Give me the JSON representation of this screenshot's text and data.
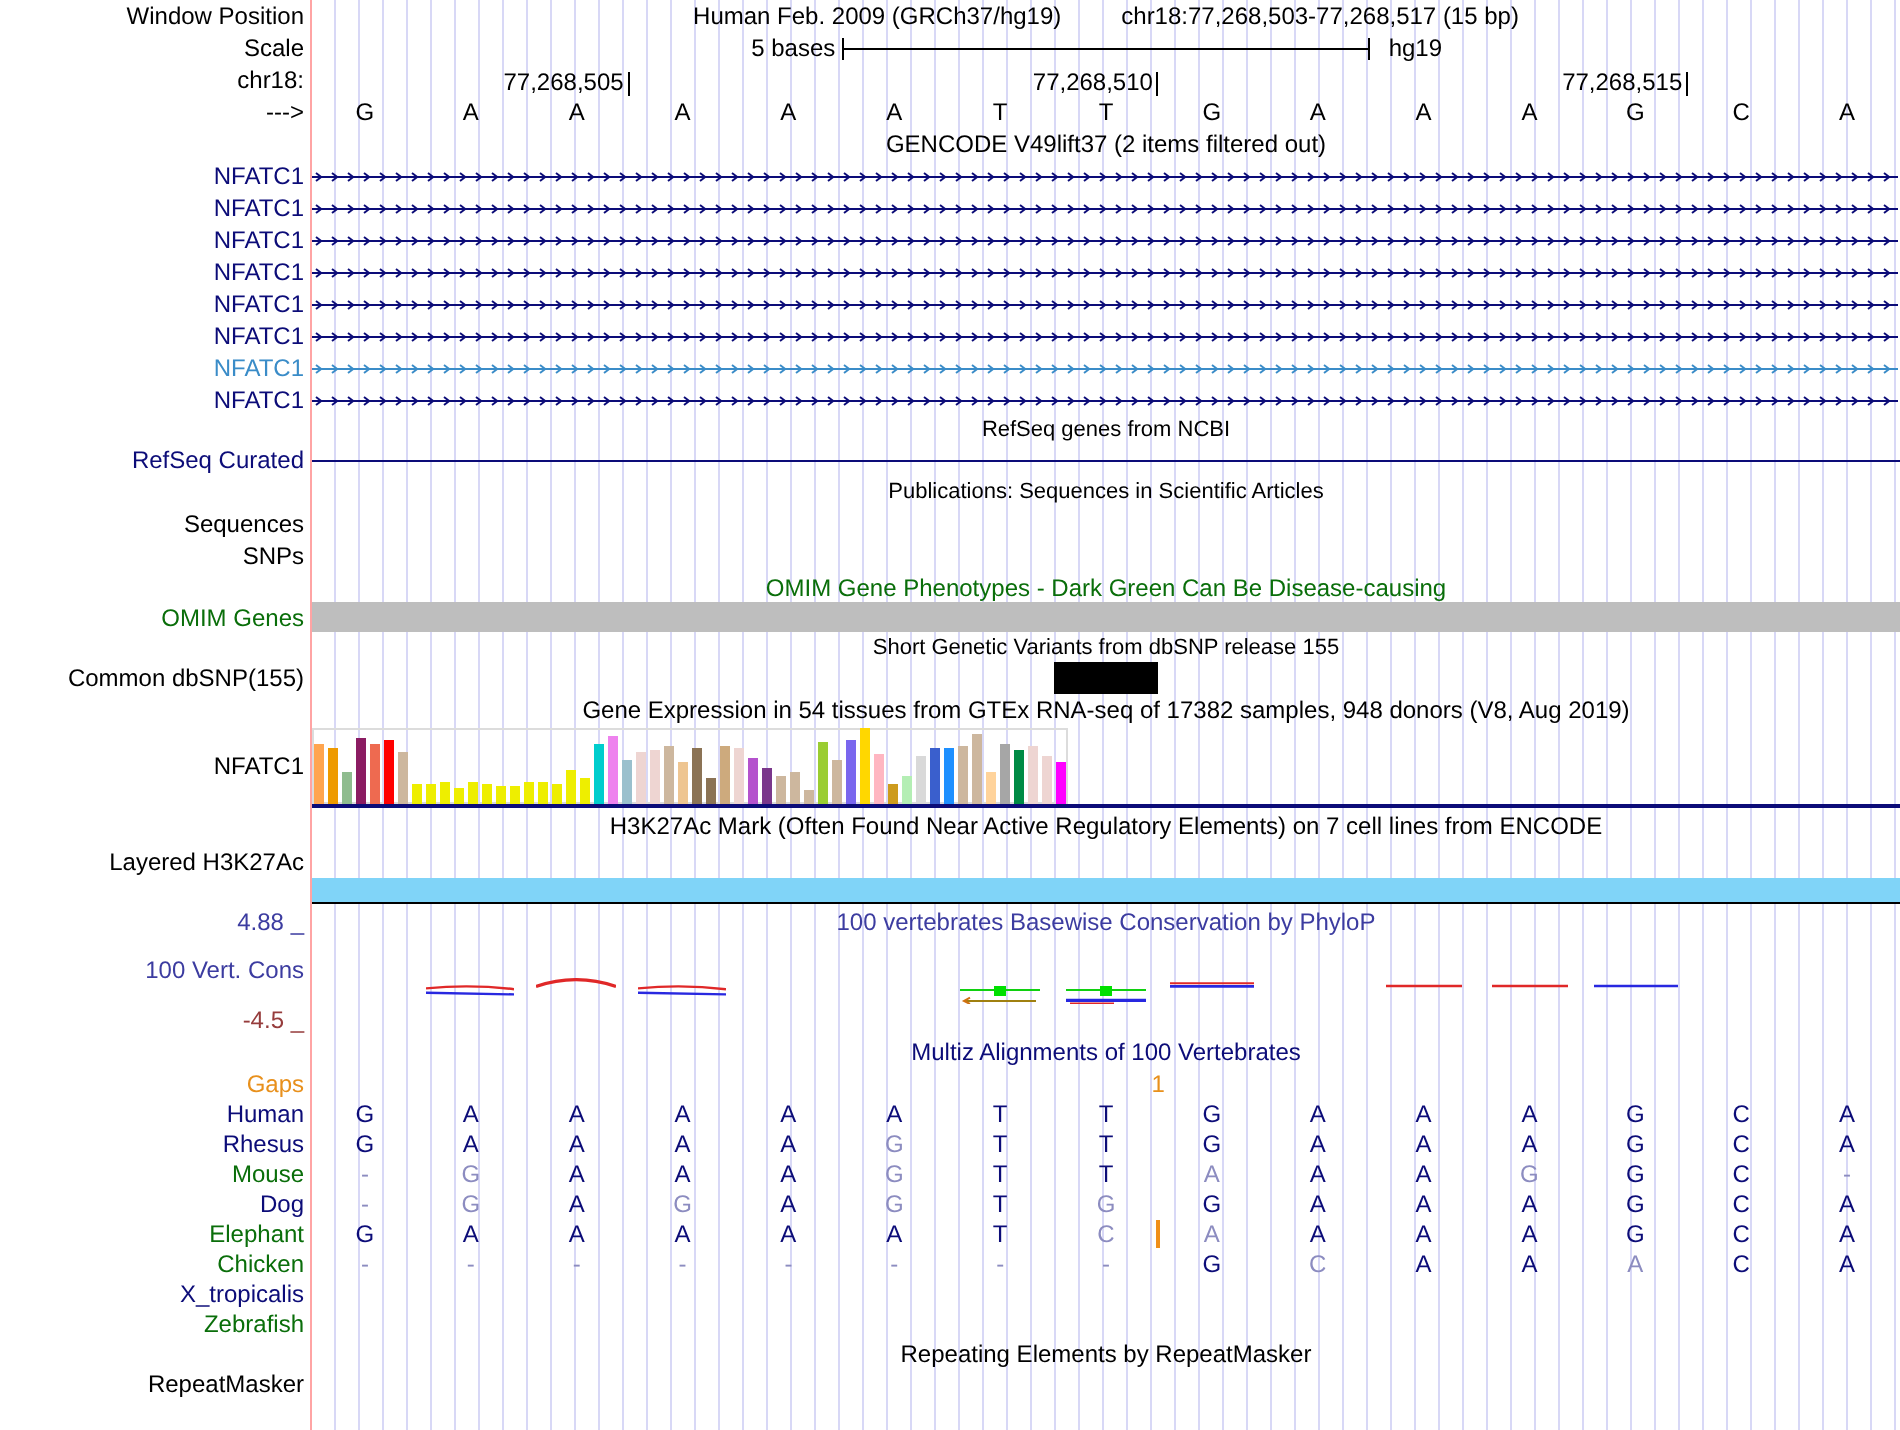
{
  "header": {
    "window_position": {
      "label": "Window Position",
      "assembly": "Human Feb. 2009 (GRCh37/hg19)",
      "position": "chr18:77,268,503-77,268,517 (15 bp)"
    },
    "scale": {
      "label": "Scale",
      "size": "5 bases",
      "assembly": "hg19"
    },
    "ruler": {
      "label": "chr18:",
      "ticks": [
        "77,268,505",
        "77,268,510",
        "77,268,515"
      ]
    },
    "strand": {
      "label": "--->",
      "bases": [
        "G",
        "A",
        "A",
        "A",
        "A",
        "A",
        "T",
        "T",
        "G",
        "A",
        "A",
        "A",
        "G",
        "C",
        "A"
      ]
    }
  },
  "gencode": {
    "title": "GENCODE V49lift37 (2 items filtered out)",
    "items": [
      {
        "label": "NFATC1",
        "color": "#0c0c78"
      },
      {
        "label": "NFATC1",
        "color": "#0c0c78"
      },
      {
        "label": "NFATC1",
        "color": "#0c0c78"
      },
      {
        "label": "NFATC1",
        "color": "#0c0c78"
      },
      {
        "label": "NFATC1",
        "color": "#0c0c78"
      },
      {
        "label": "NFATC1",
        "color": "#0c0c78"
      },
      {
        "label": "NFATC1",
        "color": "#3a8cc8"
      },
      {
        "label": "NFATC1",
        "color": "#0c0c78"
      }
    ]
  },
  "refseq": {
    "title": "RefSeq genes from NCBI",
    "label": "RefSeq Curated"
  },
  "publications": {
    "title": "Publications: Sequences in Scientific Articles",
    "labels": [
      "Sequences",
      "SNPs"
    ]
  },
  "omim": {
    "title": "OMIM Gene Phenotypes - Dark Green Can Be Disease-causing",
    "label": "OMIM Genes"
  },
  "dbsnp": {
    "title": "Short Genetic Variants from dbSNP release 155",
    "label": "Common dbSNP(155)",
    "columns": [
      {
        "variant": false
      },
      {
        "variant": false
      },
      {
        "variant": false
      },
      {
        "variant": false
      },
      {
        "variant": false
      },
      {
        "variant": false
      },
      {
        "variant": false
      },
      {
        "variant": true
      },
      {
        "variant": false
      },
      {
        "variant": false
      },
      {
        "variant": false
      },
      {
        "variant": false
      },
      {
        "variant": false
      },
      {
        "variant": false
      },
      {
        "variant": false
      }
    ]
  },
  "gtex": {
    "title": "Gene Expression in 54 tissues from GTEx RNA-seq of 17382 samples, 948 donors (V8, Aug 2019)",
    "label": "NFATC1",
    "tissues": [
      {
        "color": "#ffa54f"
      },
      {
        "color": "#ee9a00"
      },
      {
        "color": "#8fbc8f"
      },
      {
        "color": "#8b1c62"
      },
      {
        "color": "#ee6a50"
      },
      {
        "color": "#ff0000"
      },
      {
        "color": "#cdb79e"
      },
      {
        "color": "#eeee00"
      },
      {
        "color": "#eeee00"
      },
      {
        "color": "#eeee00"
      },
      {
        "color": "#eeee00"
      },
      {
        "color": "#eeee00"
      },
      {
        "color": "#eeee00"
      },
      {
        "color": "#eeee00"
      },
      {
        "color": "#eeee00"
      },
      {
        "color": "#eeee00"
      },
      {
        "color": "#eeee00"
      },
      {
        "color": "#eeee00"
      },
      {
        "color": "#eeee00"
      },
      {
        "color": "#eeee00"
      },
      {
        "color": "#00cdcd"
      },
      {
        "color": "#ee82ee"
      },
      {
        "color": "#9ac0cd"
      },
      {
        "color": "#eed5d2"
      },
      {
        "color": "#eed5d2"
      },
      {
        "color": "#cdb79e"
      },
      {
        "color": "#eec591"
      },
      {
        "color": "#8b7355"
      },
      {
        "color": "#8b7355"
      },
      {
        "color": "#cdaa7d"
      },
      {
        "color": "#eed5d2"
      },
      {
        "color": "#b452cd"
      },
      {
        "color": "#7a378b"
      },
      {
        "color": "#cdb79e"
      },
      {
        "color": "#cdb79e"
      },
      {
        "color": "#cdb79e"
      },
      {
        "color": "#9acd32"
      },
      {
        "color": "#cdb79e"
      },
      {
        "color": "#7a67ee"
      },
      {
        "color": "#ffd700"
      },
      {
        "color": "#ffb6c1"
      },
      {
        "color": "#cd9b1d"
      },
      {
        "color": "#b4eeb4"
      },
      {
        "color": "#d9d9d9"
      },
      {
        "color": "#3a5fcd"
      },
      {
        "color": "#1e90ff"
      },
      {
        "color": "#cdb79e"
      },
      {
        "color": "#cdb79e"
      },
      {
        "color": "#ffd39b"
      },
      {
        "color": "#a6a6a6"
      },
      {
        "color": "#008b45"
      },
      {
        "color": "#eed5d2"
      },
      {
        "color": "#eed5d2"
      },
      {
        "color": "#ff00ff"
      }
    ]
  },
  "h3k27ac": {
    "title": "H3K27Ac Mark (Often Found Near Active Regulatory Elements) on 7 cell lines from ENCODE",
    "label": "Layered H3K27Ac"
  },
  "phylop": {
    "title": "100 vertebrates Basewise Conservation by PhyloP",
    "label": "100 Vert. Cons",
    "max": "4.88 _",
    "min": "-4.5 _"
  },
  "multiz": {
    "title": "Multiz Alignments of 100 Vertebrates",
    "gaps": {
      "label": "Gaps",
      "columns": [
        {
          "insertion": false
        },
        {
          "insertion": false
        },
        {
          "insertion": false
        },
        {
          "insertion": false
        },
        {
          "insertion": false
        },
        {
          "insertion": false
        },
        {
          "insertion": false
        },
        {
          "insertion": true,
          "count": "1"
        },
        {
          "insertion": false
        },
        {
          "insertion": false
        },
        {
          "insertion": false
        },
        {
          "insertion": false
        },
        {
          "insertion": false
        },
        {
          "insertion": false
        },
        {
          "insertion": false
        }
      ]
    },
    "species": [
      {
        "name": "Human",
        "color": "#0c0c78",
        "bases": [
          {
            "base": "G",
            "mismatch": false
          },
          {
            "base": "A",
            "mismatch": false
          },
          {
            "base": "A",
            "mismatch": false
          },
          {
            "base": "A",
            "mismatch": false
          },
          {
            "base": "A",
            "mismatch": false
          },
          {
            "base": "A",
            "mismatch": false
          },
          {
            "base": "T",
            "mismatch": false
          },
          {
            "base": "T",
            "mismatch": false
          },
          {
            "base": "G",
            "mismatch": false
          },
          {
            "base": "A",
            "mismatch": false
          },
          {
            "base": "A",
            "mismatch": false
          },
          {
            "base": "A",
            "mismatch": false
          },
          {
            "base": "G",
            "mismatch": false
          },
          {
            "base": "C",
            "mismatch": false
          },
          {
            "base": "A",
            "mismatch": false
          }
        ]
      },
      {
        "name": "Rhesus",
        "color": "#0c0c78",
        "bases": [
          {
            "base": "G",
            "mismatch": false
          },
          {
            "base": "A",
            "mismatch": false
          },
          {
            "base": "A",
            "mismatch": false
          },
          {
            "base": "A",
            "mismatch": false
          },
          {
            "base": "A",
            "mismatch": false
          },
          {
            "base": "G",
            "mismatch": true
          },
          {
            "base": "T",
            "mismatch": false
          },
          {
            "base": "T",
            "mismatch": false
          },
          {
            "base": "G",
            "mismatch": false
          },
          {
            "base": "A",
            "mismatch": false
          },
          {
            "base": "A",
            "mismatch": false
          },
          {
            "base": "A",
            "mismatch": false
          },
          {
            "base": "G",
            "mismatch": false
          },
          {
            "base": "C",
            "mismatch": false
          },
          {
            "base": "A",
            "mismatch": false
          }
        ]
      },
      {
        "name": "Mouse",
        "color": "#0a6e0a",
        "bases": [
          {
            "base": "-",
            "mismatch": true
          },
          {
            "base": "G",
            "mismatch": true
          },
          {
            "base": "A",
            "mismatch": false
          },
          {
            "base": "A",
            "mismatch": false
          },
          {
            "base": "A",
            "mismatch": false
          },
          {
            "base": "G",
            "mismatch": true
          },
          {
            "base": "T",
            "mismatch": false
          },
          {
            "base": "T",
            "mismatch": false
          },
          {
            "base": "A",
            "mismatch": true
          },
          {
            "base": "A",
            "mismatch": false
          },
          {
            "base": "A",
            "mismatch": false
          },
          {
            "base": "G",
            "mismatch": true
          },
          {
            "base": "G",
            "mismatch": false
          },
          {
            "base": "C",
            "mismatch": false
          },
          {
            "base": "-",
            "mismatch": true
          }
        ]
      },
      {
        "name": "Dog",
        "color": "#0c0c78",
        "bases": [
          {
            "base": "-",
            "mismatch": true
          },
          {
            "base": "G",
            "mismatch": true
          },
          {
            "base": "A",
            "mismatch": false
          },
          {
            "base": "G",
            "mismatch": true
          },
          {
            "base": "A",
            "mismatch": false
          },
          {
            "base": "G",
            "mismatch": true
          },
          {
            "base": "T",
            "mismatch": false
          },
          {
            "base": "G",
            "mismatch": true
          },
          {
            "base": "G",
            "mismatch": false
          },
          {
            "base": "A",
            "mismatch": false
          },
          {
            "base": "A",
            "mismatch": false
          },
          {
            "base": "A",
            "mismatch": false
          },
          {
            "base": "G",
            "mismatch": false
          },
          {
            "base": "C",
            "mismatch": false
          },
          {
            "base": "A",
            "mismatch": false
          }
        ]
      },
      {
        "name": "Elephant",
        "color": "#0a6e0a",
        "bases": [
          {
            "base": "G",
            "mismatch": false,
            "insertion": false
          },
          {
            "base": "A",
            "mismatch": false,
            "insertion": false
          },
          {
            "base": "A",
            "mismatch": false,
            "insertion": false
          },
          {
            "base": "A",
            "mismatch": false,
            "insertion": false
          },
          {
            "base": "A",
            "mismatch": false,
            "insertion": false
          },
          {
            "base": "A",
            "mismatch": false,
            "insertion": false
          },
          {
            "base": "T",
            "mismatch": false,
            "insertion": false
          },
          {
            "base": "C",
            "mismatch": true,
            "insertion": true
          },
          {
            "base": "A",
            "mismatch": true,
            "insertion": false
          },
          {
            "base": "A",
            "mismatch": false,
            "insertion": false
          },
          {
            "base": "A",
            "mismatch": false,
            "insertion": false
          },
          {
            "base": "A",
            "mismatch": false,
            "insertion": false
          },
          {
            "base": "G",
            "mismatch": false,
            "insertion": false
          },
          {
            "base": "C",
            "mismatch": false,
            "insertion": false
          },
          {
            "base": "A",
            "mismatch": false,
            "insertion": false
          }
        ]
      },
      {
        "name": "Chicken",
        "color": "#0a6e0a",
        "bases": [
          {
            "base": "-",
            "mismatch": true
          },
          {
            "base": "-",
            "mismatch": true
          },
          {
            "base": "-",
            "mismatch": true
          },
          {
            "base": "-",
            "mismatch": true
          },
          {
            "base": "-",
            "mismatch": true
          },
          {
            "base": "-",
            "mismatch": true
          },
          {
            "base": "-",
            "mismatch": true
          },
          {
            "base": "-",
            "mismatch": true
          },
          {
            "base": "G",
            "mismatch": false
          },
          {
            "base": "C",
            "mismatch": true
          },
          {
            "base": "A",
            "mismatch": false
          },
          {
            "base": "A",
            "mismatch": false
          },
          {
            "base": "A",
            "mismatch": true
          },
          {
            "base": "C",
            "mismatch": false
          },
          {
            "base": "A",
            "mismatch": false
          }
        ]
      },
      {
        "name": "X_tropicalis",
        "color": "#0c0c78"
      },
      {
        "name": "Zebrafish",
        "color": "#0a6e0a"
      }
    ]
  },
  "repeatmasker": {
    "title": "Repeating Elements by RepeatMasker",
    "label": "RepeatMasker"
  }
}
